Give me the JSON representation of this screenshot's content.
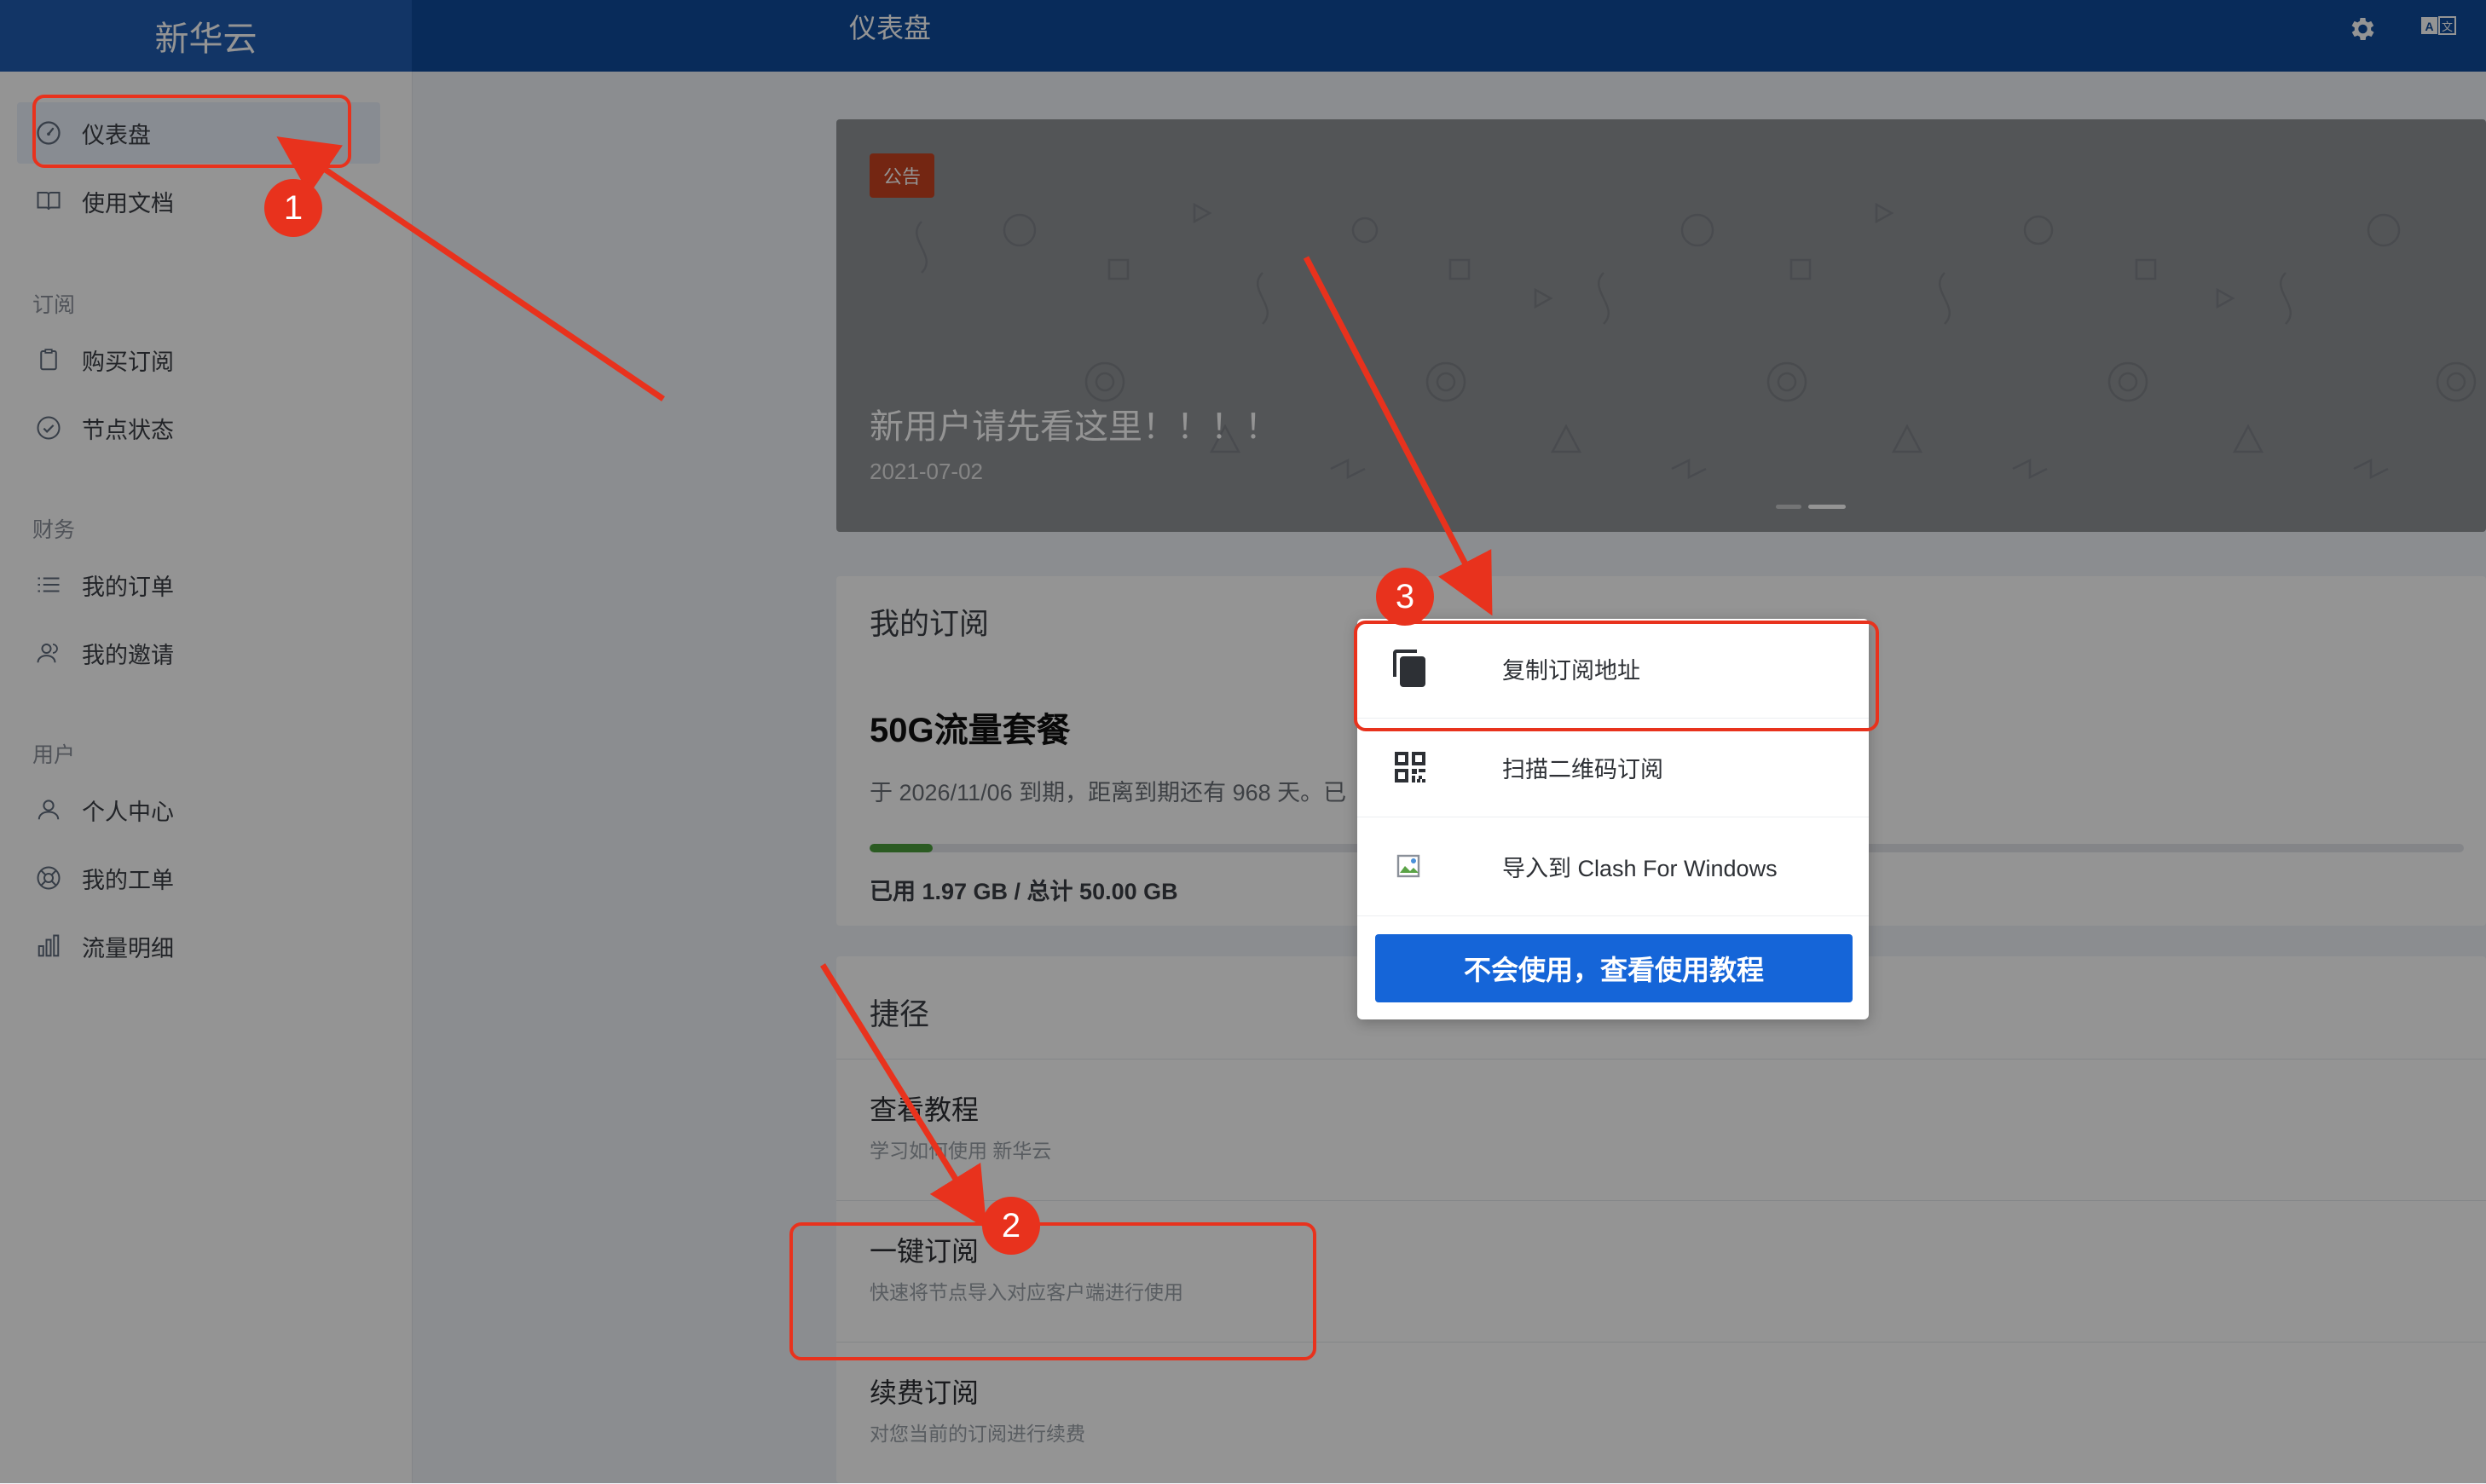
{
  "header": {
    "brand": "新华云",
    "page_title": "仪表盘",
    "settings_icon": "gear-icon",
    "language_icon": "translate-icon"
  },
  "sidebar": {
    "items": [
      {
        "label": "仪表盘",
        "icon": "dashboard-gauge-icon",
        "active": true
      },
      {
        "label": "使用文档",
        "icon": "book-icon"
      },
      {
        "section": "订阅"
      },
      {
        "label": "购买订阅",
        "icon": "clipboard-icon"
      },
      {
        "label": "节点状态",
        "icon": "check-circle-icon"
      },
      {
        "section": "财务"
      },
      {
        "label": "我的订单",
        "icon": "list-icon"
      },
      {
        "label": "我的邀请",
        "icon": "users-icon"
      },
      {
        "section": "用户"
      },
      {
        "label": "个人中心",
        "icon": "user-icon"
      },
      {
        "label": "我的工单",
        "icon": "lifebuoy-icon"
      },
      {
        "label": "流量明细",
        "icon": "bar-chart-icon"
      }
    ]
  },
  "banner": {
    "badge": "公告",
    "title": "新用户请先看这里！！！！",
    "date": "2021-07-02"
  },
  "subscription": {
    "title": "我的订阅",
    "plan_name": "50G流量套餐",
    "expire_text": "于 2026/11/06 到期，距离到期还有 968 天。已",
    "usage_text": "已用 1.97 GB / 总计 50.00 GB",
    "used_fraction": 0.0394,
    "accent": "#4a9e3c"
  },
  "shortcuts": {
    "title": "捷径",
    "items": [
      {
        "title": "查看教程",
        "desc": "学习如何使用 新华云"
      },
      {
        "title": "一键订阅",
        "desc": "快速将节点导入对应客户端进行使用"
      },
      {
        "title": "续费订阅",
        "desc": "对您当前的订阅进行续费"
      }
    ]
  },
  "subscribe_menu": {
    "items": [
      {
        "label": "复制订阅地址",
        "icon": "copy-icon"
      },
      {
        "label": "扫描二维码订阅",
        "icon": "qr-code-icon"
      },
      {
        "label": "导入到 Clash For Windows",
        "icon": "broken-image-icon"
      }
    ],
    "tutorial_button": "不会使用，查看使用教程",
    "button_color": "#1565d8"
  },
  "annotations": {
    "step_1": "1",
    "step_2": "2",
    "step_3": "3",
    "color": "#e8321d"
  }
}
